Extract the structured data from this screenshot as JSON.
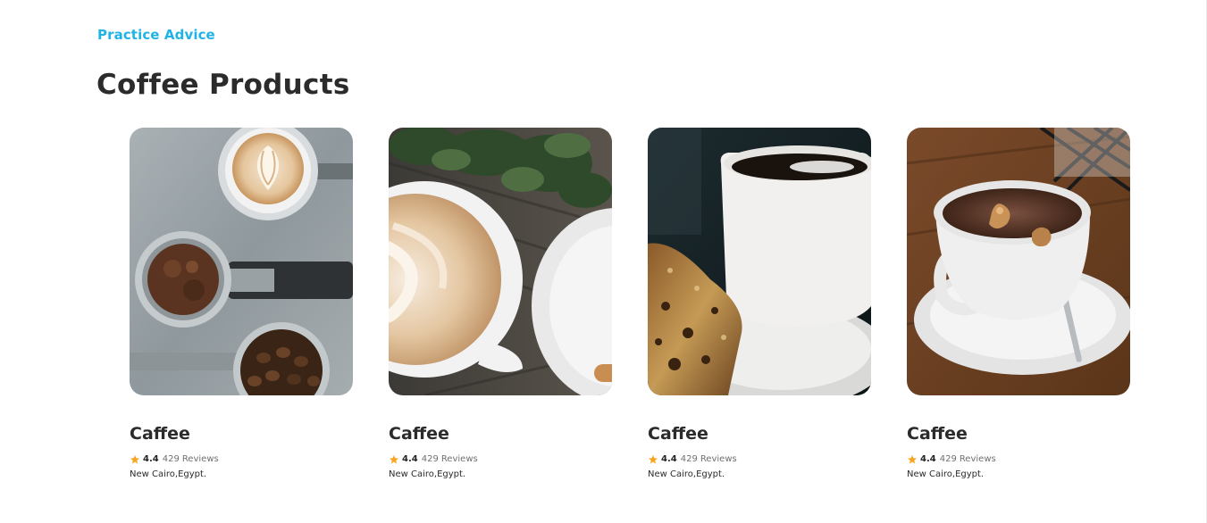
{
  "section": {
    "eyebrow": "Practice Advice",
    "title": "Coffee Products"
  },
  "colors": {
    "accent": "#1fb3e6",
    "star": "#f5a623",
    "heading": "#2b2b2b",
    "muted": "#6f6f6f"
  },
  "cards": [
    {
      "title": "Caffee",
      "image": "espresso-portafilters-photo",
      "star_icon": "star-icon",
      "rating": "4.4",
      "review_count": "429",
      "review_label": "Reviews",
      "location": "New Cairo,Egypt."
    },
    {
      "title": "Caffee",
      "image": "latte-art-cup-photo",
      "star_icon": "star-icon",
      "rating": "4.4",
      "review_count": "429",
      "review_label": "Reviews",
      "location": "New Cairo,Egypt."
    },
    {
      "title": "Caffee",
      "image": "black-coffee-and-cake-photo",
      "star_icon": "star-icon",
      "rating": "4.4",
      "review_count": "429",
      "review_label": "Reviews",
      "location": "New Cairo,Egypt."
    },
    {
      "title": "Caffee",
      "image": "cappuccino-saucer-photo",
      "star_icon": "star-icon",
      "rating": "4.4",
      "review_count": "429",
      "review_label": "Reviews",
      "location": "New Cairo,Egypt."
    }
  ]
}
